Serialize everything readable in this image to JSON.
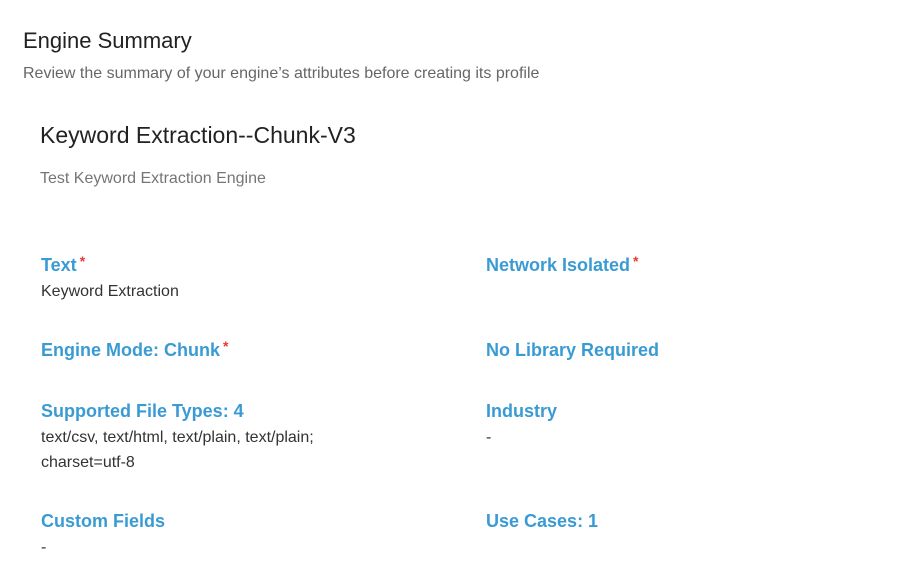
{
  "header": {
    "title": "Engine Summary",
    "subtitle": "Review the summary of your engine’s attributes before creating its profile"
  },
  "engine": {
    "name": "Keyword Extraction--Chunk-V3",
    "description": "Test Keyword Extraction Engine"
  },
  "required_marker": "*",
  "fields": {
    "text": {
      "label": "Text",
      "required": true,
      "value": "Keyword Extraction"
    },
    "network_isolated": {
      "label": "Network Isolated",
      "required": true,
      "value": ""
    },
    "engine_mode": {
      "label": "Engine Mode: Chunk",
      "required": true,
      "value": ""
    },
    "library": {
      "label": "No Library Required",
      "required": false,
      "value": ""
    },
    "file_types": {
      "label": "Supported File Types: 4",
      "required": false,
      "value": "text/csv, text/html, text/plain, text/plain; charset=utf-8"
    },
    "industry": {
      "label": "Industry",
      "required": false,
      "value": "-"
    },
    "custom_fields": {
      "label": "Custom Fields",
      "required": false,
      "value": "-"
    },
    "use_cases": {
      "label": "Use Cases: 1",
      "required": false,
      "value": ""
    }
  },
  "colors": {
    "label": "#3a9bd4",
    "required": "#e53935",
    "title": "#222222",
    "subtitle": "#666666"
  }
}
